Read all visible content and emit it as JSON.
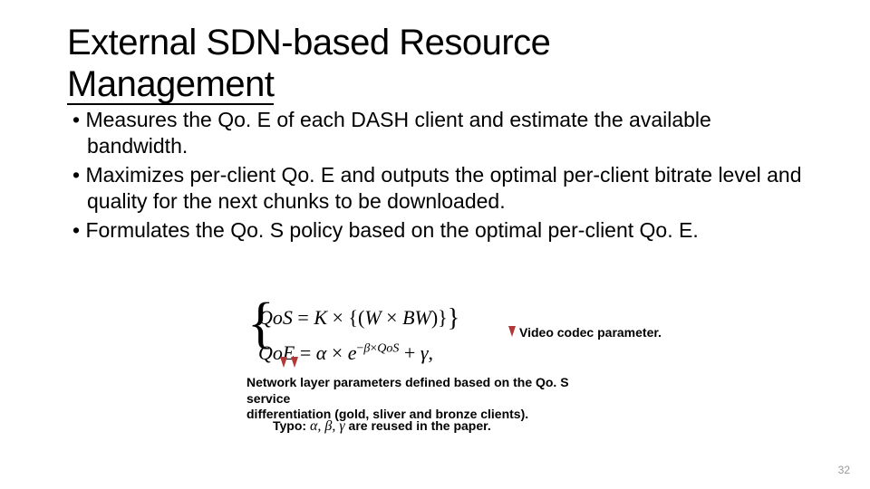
{
  "title_line1": "External SDN-based Resource",
  "title_line2": "Management",
  "bullets": [
    "Measures  the Qo. E of each DASH client and estimate the available bandwidth.",
    "Maximizes per-client Qo. E and outputs the optimal per-client bitrate level and quality for the next chunks to be downloaded.",
    "Formulates the Qo. S policy based on the optimal per-client Qo. E."
  ],
  "formula": {
    "line1": {
      "lhs": "QoS",
      "eq": " = ",
      "K": "K",
      "times1": " × ",
      "lb": "{(",
      "W": "W",
      "times2": " × ",
      "BW": "BW",
      "rb": ")}"
    },
    "line2": {
      "lhs": "QoE",
      "eq": " = ",
      "alpha": "α",
      "times": " × ",
      "e": "e",
      "exp_minus": "−",
      "exp_beta": "β",
      "exp_times": "×",
      "exp_qos": "QoS",
      "plus": " + ",
      "gamma": "γ",
      "comma": ","
    }
  },
  "annotation_right": "Video codec parameter.",
  "annotation_below_line1": "Network layer parameters defined based on the Qo. S service",
  "annotation_below_line2": "differentiation (gold, sliver and bronze clients).",
  "typo_prefix": "Typo: ",
  "typo_math": "α, β, γ",
  "typo_suffix": " are reused in the paper.",
  "page_number": "32"
}
